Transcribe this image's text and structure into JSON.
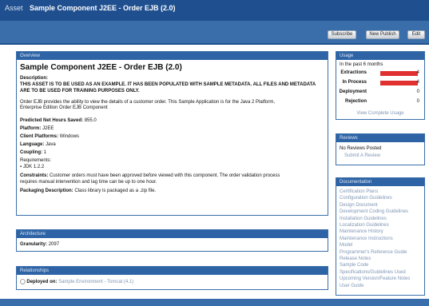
{
  "header": {
    "asset_label": "Asset",
    "asset_name": "Sample Component J2EE - Order EJB (2.0)"
  },
  "toolbar": {
    "subscribe": "Subscribe",
    "new_publish": "New Publish",
    "edit": "Edit"
  },
  "overview": {
    "heading": "Overview",
    "title": "Sample Component J2EE - Order EJB (2.0)",
    "description_label": "Description:",
    "notice": "THIS ASSET IS TO BE USED AS AN EXAMPLE. IT HAS BEEN POPULATED WITH SAMPLE METADATA. ALL FILES AND METADATA ARE TO BE USED FOR TRAINING PURPOSES ONLY.",
    "body_1": "Order EJB provides the ability to view the details of a customer order. This Sample Application is for the Java 2 Platform,",
    "body_2": "Enterprise Edition Order EJB Component",
    "fields": {
      "hours_label": "Predicted Net Hours Saved:",
      "hours_value": "855.0",
      "platform_label": "Platform:",
      "platform_value": "J2EE",
      "client_label": "Client Platforms:",
      "client_value": "Windows",
      "language_label": "Language:",
      "language_value": "Java",
      "coupling_label": "Coupling:",
      "coupling_value": "1",
      "requirements_label": "Requirements:",
      "requirements_value": "JDK 1.2.2",
      "constraints_label": "Constraints:",
      "constraints_value": "Customer orders must have been approved before viewed with this component. The order validation process",
      "constraints_value_2": "requires manual intervention and lag time can be up to one hour.",
      "packaging_label": "Packaging Description:",
      "packaging_value": "Class library is packaged as a .zip file."
    }
  },
  "architecture": {
    "heading": "Architecture",
    "granularity_label": "Granularity:",
    "granularity_value": "2097"
  },
  "relationships": {
    "heading": "Relationships",
    "deployed_label": "Deployed on:",
    "deployed_value": "Sample Environment - Tomcat (4.1)"
  },
  "usage": {
    "heading": "Usage",
    "period": "In the past 6 months",
    "rows": [
      {
        "label": "Extractions",
        "value": "4",
        "fraction": 1.0
      },
      {
        "label": "In Process",
        "value": "4",
        "fraction": 1.0
      },
      {
        "label": "Deployment",
        "value": "0",
        "fraction": 0
      },
      {
        "label": "Rejection",
        "value": "0",
        "fraction": 0
      }
    ],
    "view_complete": "View Complete Usage"
  },
  "reviews": {
    "heading": "Reviews",
    "none": "No Reviews Posted",
    "submit": "Submit A Review"
  },
  "documentation": {
    "heading": "Documentation",
    "items": [
      "Certification Plans",
      "Configuration Guidelines",
      "Design Document",
      "Development Coding Guidelines",
      "Installation Guidelines",
      "Localization Guidelines",
      "Maintenance History",
      "Maintenance Instructions",
      "Model",
      "Programmer's Reference Guide",
      "Release Notes",
      "Sample Code",
      "Specifications/Guidelines Used",
      "Upcoming Version/Feature Notes",
      "User Guide"
    ]
  },
  "colors": {
    "header": "#1f4f8f",
    "toolbar": "#3a6eaa",
    "panel_header": "#2e64a6",
    "bar": "#e03030",
    "link": "#7f96b5"
  }
}
